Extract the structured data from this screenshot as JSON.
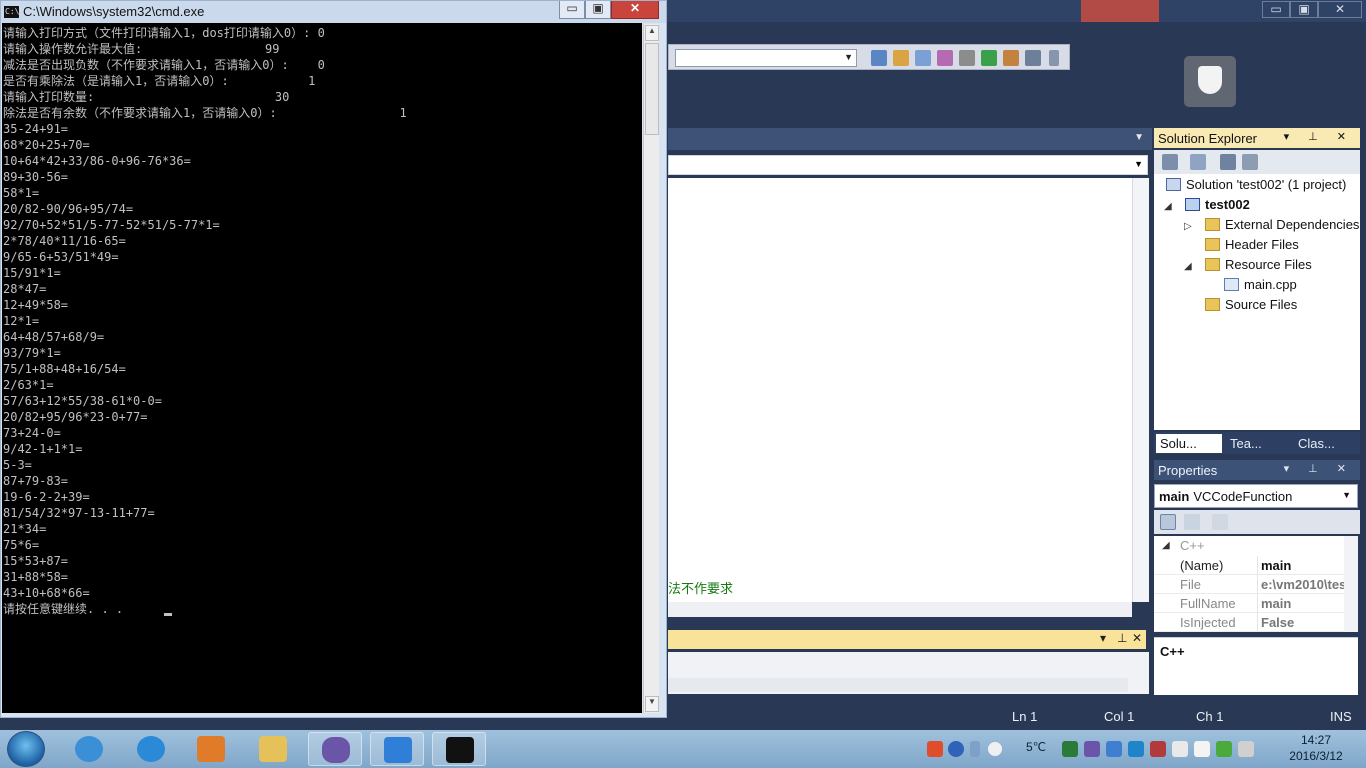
{
  "cmd": {
    "title": "C:\\Windows\\system32\\cmd.exe",
    "controls": {
      "minimize": "▭",
      "maximize": "▣",
      "close": "✕"
    },
    "lines": [
      "请输入打印方式（文件打印请输入1，dos打印请输入0）: 0",
      "请输入操作数允许最大值:                 99",
      "减法是否出现负数（不作要求请输入1，否请输入0）:    0",
      "是否有乘除法（是请输入1，否请输入0）:           1",
      "请输入打印数量:                         30",
      "除法是否有余数（不作要求请输入1，否请输入0）:                 1",
      "35-24+91=",
      "68*20+25+70=",
      "10+64*42+33/86-0+96-76*36=",
      "89+30-56=",
      "58*1=",
      "20/82-90/96+95/74=",
      "92/70+52*51/5-77-52*51/5-77*1=",
      "2*78/40*11/16-65=",
      "9/65-6+53/51*49=",
      "15/91*1=",
      "28*47=",
      "12+49*58=",
      "12*1=",
      "64+48/57+68/9=",
      "93/79*1=",
      "75/1+88+48+16/54=",
      "2/63*1=",
      "57/63+12*55/38-61*0-0=",
      "20/82+95/96*23-0+77=",
      "73+24-0=",
      "9/42-1+1*1=",
      "5-3=",
      "87+79-83=",
      "19-6-2-2+39=",
      "81/54/32*97-13-11+77=",
      "21*34=",
      "75*6=",
      "15*53+87=",
      "31+88*58=",
      "43+10+68*66=",
      "请按任意键继续. . ."
    ]
  },
  "vs": {
    "window_controls": {
      "minimize": "▭",
      "maximize": "▣",
      "close": "✕"
    },
    "editor_comment": "法不作要求",
    "solution_explorer": {
      "title": "Solution Explorer",
      "title_controls": "▾ ⊥ ✕",
      "items": [
        {
          "label": "Solution 'test002' (1 project)",
          "icon": "solution-icon"
        },
        {
          "label": "test002",
          "icon": "project-icon"
        },
        {
          "label": "External Dependencies",
          "icon": "folder-icon"
        },
        {
          "label": "Header Files",
          "icon": "folder-icon"
        },
        {
          "label": "Resource Files",
          "icon": "folder-icon"
        },
        {
          "label": "main.cpp",
          "icon": "cpp-file-icon"
        },
        {
          "label": "Source Files",
          "icon": "folder-icon"
        }
      ],
      "tabs": [
        "Solu...",
        "Tea...",
        "Clas..."
      ]
    },
    "properties": {
      "title": "Properties",
      "title_controls": "▾ ⊥ ✕",
      "object_name": "main",
      "object_type": "VCCodeFunction",
      "category": "C++",
      "rows": [
        {
          "key": "(Name)",
          "value": "main"
        },
        {
          "key": "File",
          "value": "e:\\vm2010\\tes"
        },
        {
          "key": "FullName",
          "value": "main"
        },
        {
          "key": "IsInjected",
          "value": "False"
        }
      ],
      "description": "C++"
    },
    "status": {
      "ln": "Ln 1",
      "col": "Col 1",
      "ch": "Ch 1",
      "mode": "INS"
    }
  },
  "taskbar": {
    "temperature": "5℃",
    "time": "14:27",
    "date": "2016/3/12"
  },
  "colors": {
    "cmd_background": "#000000",
    "cmd_text": "#c0c0c0",
    "vs_frame": "#293955",
    "editor_comment": "#147b10",
    "output_title": "#f9e39b",
    "close_button": "#c9443a"
  }
}
